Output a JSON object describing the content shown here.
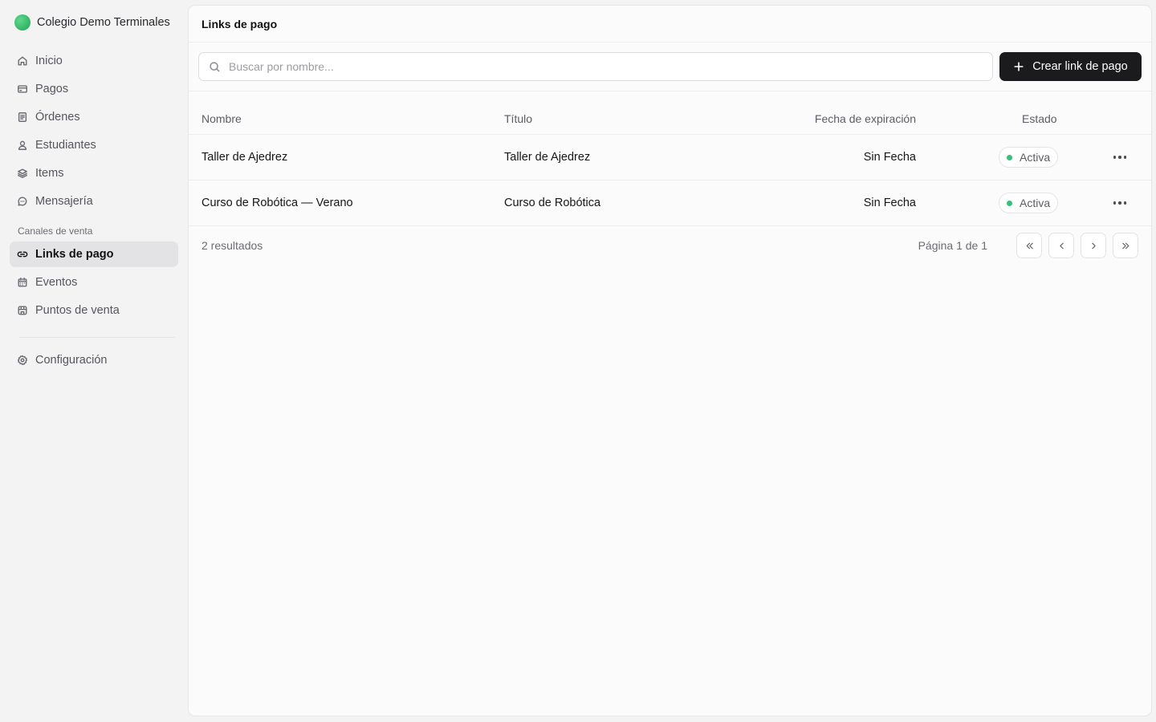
{
  "org": {
    "name": "Colegio Demo Terminales"
  },
  "sidebar": {
    "items": [
      {
        "label": "Inicio",
        "icon": "home-icon"
      },
      {
        "label": "Pagos",
        "icon": "credit-card-icon"
      },
      {
        "label": "Órdenes",
        "icon": "receipt-icon"
      },
      {
        "label": "Estudiantes",
        "icon": "user-icon"
      },
      {
        "label": "Items",
        "icon": "layers-icon"
      },
      {
        "label": "Mensajería",
        "icon": "message-icon"
      }
    ],
    "section_label": "Canales de venta",
    "channels": [
      {
        "label": "Links de pago",
        "icon": "link-icon",
        "active": true
      },
      {
        "label": "Eventos",
        "icon": "calendar-icon"
      },
      {
        "label": "Puntos de venta",
        "icon": "store-icon"
      }
    ],
    "settings": {
      "label": "Configuración",
      "icon": "gear-icon"
    }
  },
  "header": {
    "title": "Links de pago"
  },
  "search": {
    "placeholder": "Buscar por nombre..."
  },
  "create_button": {
    "label": "Crear link de pago"
  },
  "table": {
    "columns": [
      "Nombre",
      "Título",
      "Fecha de expiración",
      "Estado"
    ],
    "rows": [
      {
        "name": "Taller de Ajedrez",
        "title": "Taller de Ajedrez",
        "expiration": "Sin Fecha",
        "status": "Activa"
      },
      {
        "name": "Curso de Robótica — Verano",
        "title": "Curso de Robótica",
        "expiration": "Sin Fecha",
        "status": "Activa"
      }
    ]
  },
  "footer": {
    "results": "2 resultados",
    "page": "Página 1 de 1"
  },
  "colors": {
    "accent": "#1b1b1d",
    "status_active": "#35c07c",
    "brand": "#1fa457"
  }
}
